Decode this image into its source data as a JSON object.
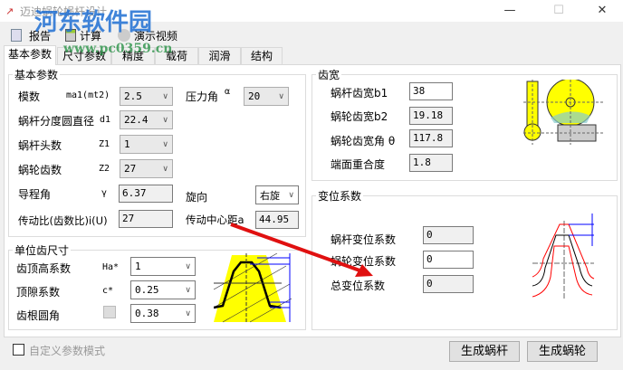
{
  "window": {
    "title": "迈迪蜗轮蜗杆设计",
    "minimize": "—",
    "maximize": "☐",
    "close": "✕"
  },
  "watermark": {
    "name": "河东软件园",
    "url": "www.pc0359.cn"
  },
  "toolbar": {
    "report": "报告",
    "calc": "计算",
    "video": "演示视频"
  },
  "tabs": [
    "基本参数",
    "尺寸参数",
    "精度",
    "载荷",
    "润滑",
    "结构"
  ],
  "basic": {
    "title": "基本参数",
    "module": {
      "label": "模数",
      "sym": "ma1(mt2)",
      "value": "2.5"
    },
    "pressure": {
      "label": "压力角",
      "sym": "α",
      "value": "20"
    },
    "d1": {
      "label": "蜗杆分度圆直径",
      "sym": "d1",
      "value": "22.4"
    },
    "z1": {
      "label": "蜗杆头数",
      "sym": "Z1",
      "value": "1"
    },
    "z2": {
      "label": "蜗轮齿数",
      "sym": "Z2",
      "value": "27"
    },
    "lead": {
      "label": "导程角",
      "sym": "γ",
      "value": "6.37"
    },
    "hand": {
      "label": "旋向",
      "value": "右旋"
    },
    "ratio": {
      "label": "传动比(齿数比)i(U)",
      "value": "27"
    },
    "center": {
      "label": "传动中心距a",
      "value": "44.95"
    }
  },
  "unit": {
    "title": "单位齿尺寸",
    "ha": {
      "label": "齿顶高系数",
      "sym": "Ha*",
      "value": "1"
    },
    "c": {
      "label": "顶隙系数",
      "sym": "c*",
      "value": "0.25"
    },
    "r": {
      "label": "齿根圆角",
      "value": "0.38"
    }
  },
  "width": {
    "title": "齿宽",
    "b1": {
      "label": "蜗杆齿宽b1",
      "value": "38"
    },
    "b2": {
      "label": "蜗轮齿宽b2",
      "value": "19.18"
    },
    "theta": {
      "label": "蜗轮齿宽角 θ",
      "value": "117.8"
    },
    "eps": {
      "label": "端面重合度",
      "value": "1.8"
    }
  },
  "shift": {
    "title": "变位系数",
    "x1": {
      "label": "蜗杆变位系数",
      "value": "0"
    },
    "x2": {
      "label": "蜗轮变位系数",
      "value": "0"
    },
    "xs": {
      "label": "总变位系数",
      "value": "0"
    }
  },
  "footer": {
    "custom": "自定义参数模式",
    "gen_worm": "生成蜗杆",
    "gen_wheel": "生成蜗轮"
  }
}
